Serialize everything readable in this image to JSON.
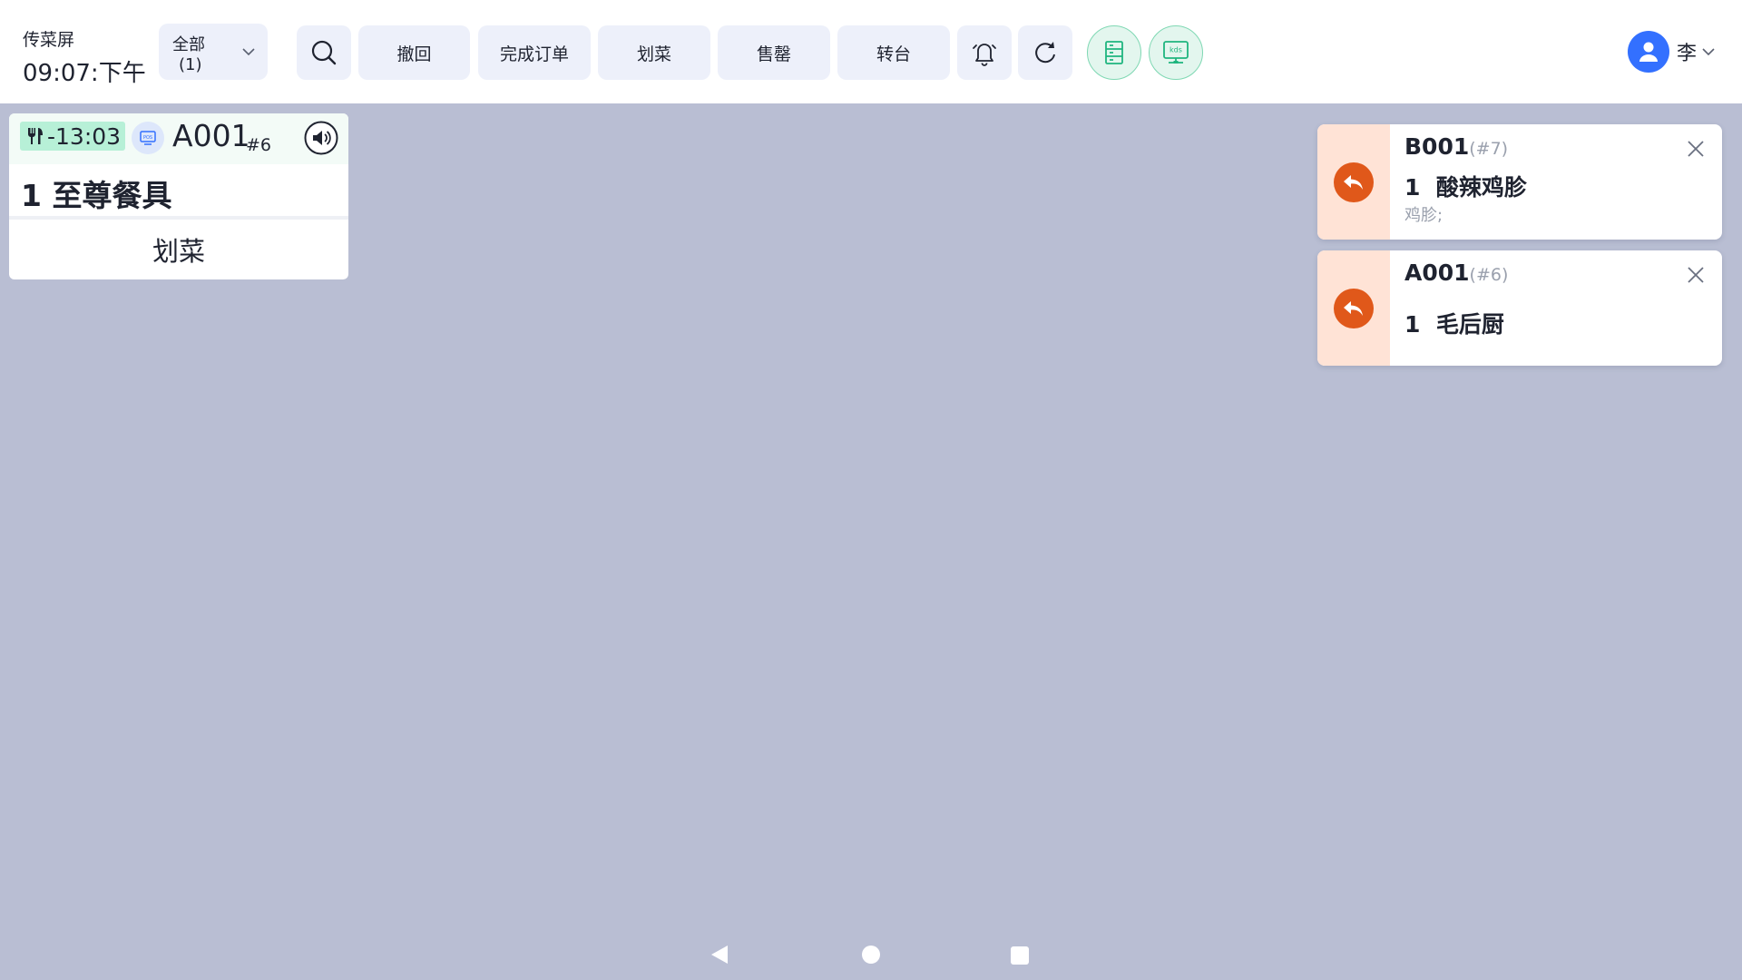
{
  "header": {
    "title": "传菜屏",
    "time": "09:07:下午",
    "filter": {
      "label": "全部",
      "count": "(1)"
    },
    "buttons": {
      "revoke": "撤回",
      "complete_order": "完成订单",
      "mark_dish": "划菜",
      "sold_out": "售罄",
      "transfer_table": "转台"
    },
    "user": {
      "name": "李"
    }
  },
  "order_card": {
    "timer": "-13:03",
    "table": "A001",
    "seq": "#6",
    "item": "1 至尊餐具",
    "action": "划菜"
  },
  "notifications": [
    {
      "table": "B001",
      "seq": "(#7)",
      "qty": "1",
      "dish": "酸辣鸡胗",
      "note": "鸡胗;"
    },
    {
      "table": "A001",
      "seq": "(#6)",
      "qty": "1",
      "dish": "毛后厨",
      "note": ""
    }
  ],
  "colors": {
    "background": "#b9bed3",
    "button_bg": "#edf0fa",
    "timer_bg": "#b7f0d7",
    "accent_orange": "#e0581a",
    "notif_side": "#ffe3d6",
    "accent_blue": "#3370ff",
    "accent_green": "#1fb57f"
  },
  "icons": {
    "search": "search-icon",
    "bell": "bell-icon",
    "refresh": "refresh-icon",
    "server": "server-icon",
    "kds": "kds-monitor-icon",
    "user": "user-avatar-icon",
    "dining": "utensils-icon",
    "pos": "pos-icon",
    "sound": "speaker-icon",
    "undo": "undo-arrow-icon",
    "close": "close-icon"
  }
}
